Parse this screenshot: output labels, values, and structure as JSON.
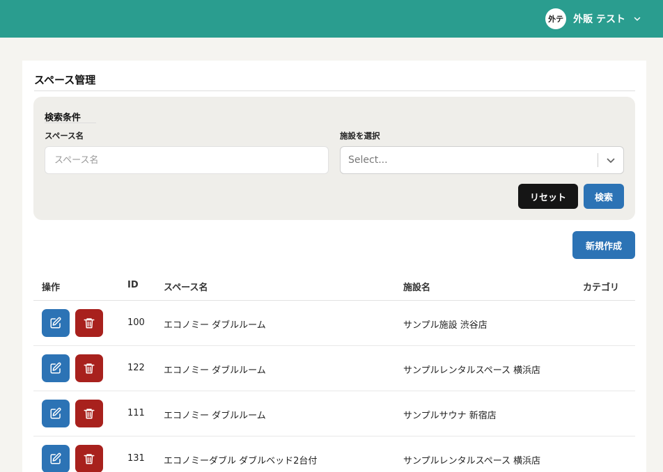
{
  "header": {
    "avatar_text": "外テ",
    "user_name": "外販 テスト"
  },
  "page": {
    "title": "スペース管理"
  },
  "search": {
    "title": "検索条件",
    "space_name_label": "スペース名",
    "space_name_placeholder": "スペース名",
    "facility_label": "施設を選択",
    "facility_placeholder": "Select...",
    "reset_label": "リセット",
    "search_label": "検索"
  },
  "actions": {
    "new_label": "新規作成"
  },
  "table": {
    "headers": {
      "actions": "操作",
      "id": "ID",
      "space_name": "スペース名",
      "facility_name": "施設名",
      "category": "カテゴリ"
    },
    "rows": [
      {
        "id": "100",
        "space_name": "エコノミー ダブルルーム",
        "facility_name": "サンプル施設 渋谷店",
        "category": ""
      },
      {
        "id": "122",
        "space_name": "エコノミー ダブルルーム",
        "facility_name": "サンプルレンタルスペース 横浜店",
        "category": ""
      },
      {
        "id": "111",
        "space_name": "エコノミー ダブルルーム",
        "facility_name": "サンプルサウナ 新宿店",
        "category": ""
      },
      {
        "id": "131",
        "space_name": "エコノミーダブル ダブルベッド2台付",
        "facility_name": "サンプルレンタルスペース 横浜店",
        "category": ""
      }
    ]
  },
  "colors": {
    "header_bg": "#2a9d8f",
    "primary": "#2c73b5",
    "danger": "#a8211d",
    "dark": "#151515"
  },
  "icons": {
    "edit": "edit-icon",
    "delete": "trash-icon",
    "user_menu": "chevron-down-icon",
    "select": "chevron-down-icon"
  }
}
